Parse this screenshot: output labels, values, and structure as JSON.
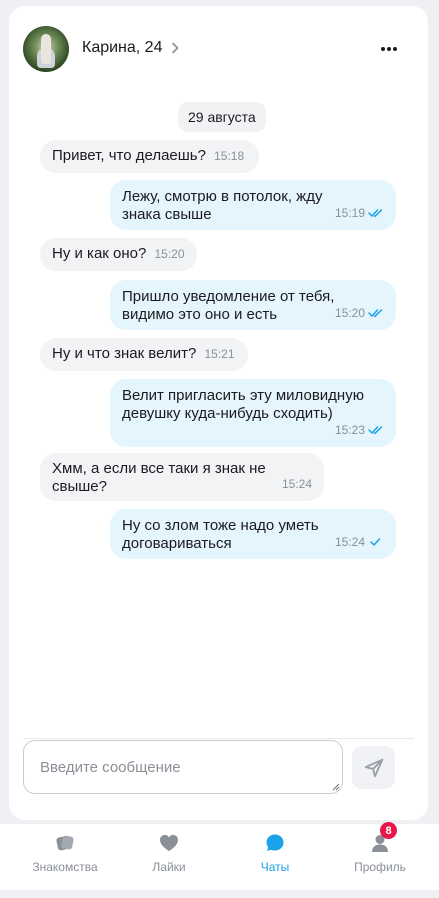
{
  "header": {
    "contact_name": "Карина, 24"
  },
  "chat": {
    "date_separator": "29 августа",
    "messages": [
      {
        "dir": "in",
        "text": "Привет, что делаешь?",
        "time": "15:18"
      },
      {
        "dir": "out",
        "text": "Лежу, смотрю в потолок, жду знака свыше",
        "time": "15:19",
        "status": "read"
      },
      {
        "dir": "in",
        "text": "Ну и как оно?",
        "time": "15:20"
      },
      {
        "dir": "out",
        "text": "Пришло уведомление от тебя, видимо это оно и есть",
        "time": "15:20",
        "status": "read"
      },
      {
        "dir": "in",
        "text": "Ну и что знак велит?",
        "time": "15:21"
      },
      {
        "dir": "out",
        "text": "Велит пригласить эту миловидную девушку куда-нибудь сходить)",
        "time": "15:23",
        "status": "read"
      },
      {
        "dir": "in",
        "text": "Хмм, а если все таки я знак не свыше?",
        "time": "15:24"
      },
      {
        "dir": "out",
        "text": "Ну со злом тоже надо уметь договариваться",
        "time": "15:24",
        "status": "sent"
      }
    ]
  },
  "composer": {
    "placeholder": "Введите сообщение"
  },
  "tabbar": {
    "items": [
      {
        "label": "Знакомства",
        "icon": "cards-icon"
      },
      {
        "label": "Лайки",
        "icon": "heart-icon"
      },
      {
        "label": "Чаты",
        "icon": "chat-bubble-icon",
        "active": true
      },
      {
        "label": "Профиль",
        "icon": "person-icon",
        "badge": "8"
      }
    ]
  },
  "colors": {
    "accent": "#1aa3e8",
    "outgoing_bubble": "#e4f5fe",
    "incoming_bubble": "#f2f3f5",
    "badge": "#e8174a"
  }
}
